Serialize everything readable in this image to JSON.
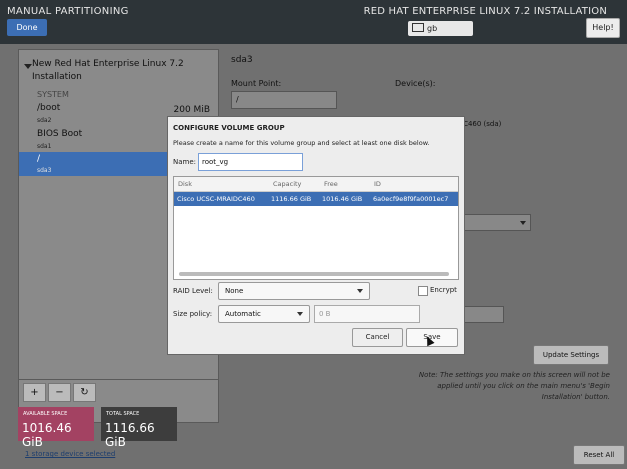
{
  "header": {
    "title_left": "MANUAL PARTITIONING",
    "done_label": "Done",
    "title_right": "RED HAT ENTERPRISE LINUX 7.2 INSTALLATION",
    "keyboard_layout": "gb",
    "help_label": "Help!"
  },
  "sidebar": {
    "installation_title": "New Red Hat Enterprise Linux 7.2 Installation",
    "system_label": "SYSTEM",
    "partitions": [
      {
        "mount": "/boot",
        "device": "sda2",
        "size": "200 MiB"
      },
      {
        "mount": "BIOS Boot",
        "device": "sda1",
        "size": ""
      },
      {
        "mount": "/",
        "device": "sda3",
        "size": ""
      }
    ],
    "tools": {
      "add": "+",
      "remove": "−",
      "refresh": "↻"
    }
  },
  "space": {
    "available_label": "AVAILABLE SPACE",
    "available_value": "1016.46 GiB",
    "total_label": "TOTAL SPACE",
    "total_value": "1116.66 GiB",
    "storage_link": "1 storage device selected"
  },
  "detail": {
    "title": "sda3",
    "mount_point_label": "Mount Point:",
    "mount_point_value": "/",
    "devices_label": "Device(s):",
    "device_value_peek": "IC460 (sda)",
    "update_label": "Update Settings",
    "note": "Note: The settings you make on this screen will not be applied until you click on the main menu's 'Begin Installation' button.",
    "reset_label": "Reset All"
  },
  "dialog": {
    "title": "CONFIGURE VOLUME GROUP",
    "instructions": "Please create a name for this volume group and select at least one disk below.",
    "name_label": "Name:",
    "name_value": "root_vg",
    "columns": [
      "Disk",
      "Capacity",
      "Free",
      "ID"
    ],
    "disks": [
      {
        "disk": "Cisco UCSC-MRAIDC460",
        "capacity": "1116.66 GiB",
        "free": "1016.46 GiB",
        "id": "6a0ecf9e8f9fa0001ec7"
      }
    ],
    "raid_label": "RAID Level:",
    "raid_value": "None",
    "encrypt_label": "Encrypt",
    "policy_label": "Size policy:",
    "policy_value": "Automatic",
    "size_value": "0 B",
    "cancel_label": "Cancel",
    "save_label": "Save"
  },
  "colors": {
    "accent": "#3c6eb4",
    "available_bg": "#a34262",
    "total_bg": "#3d3d3d",
    "header_bg": "#2d3438"
  }
}
